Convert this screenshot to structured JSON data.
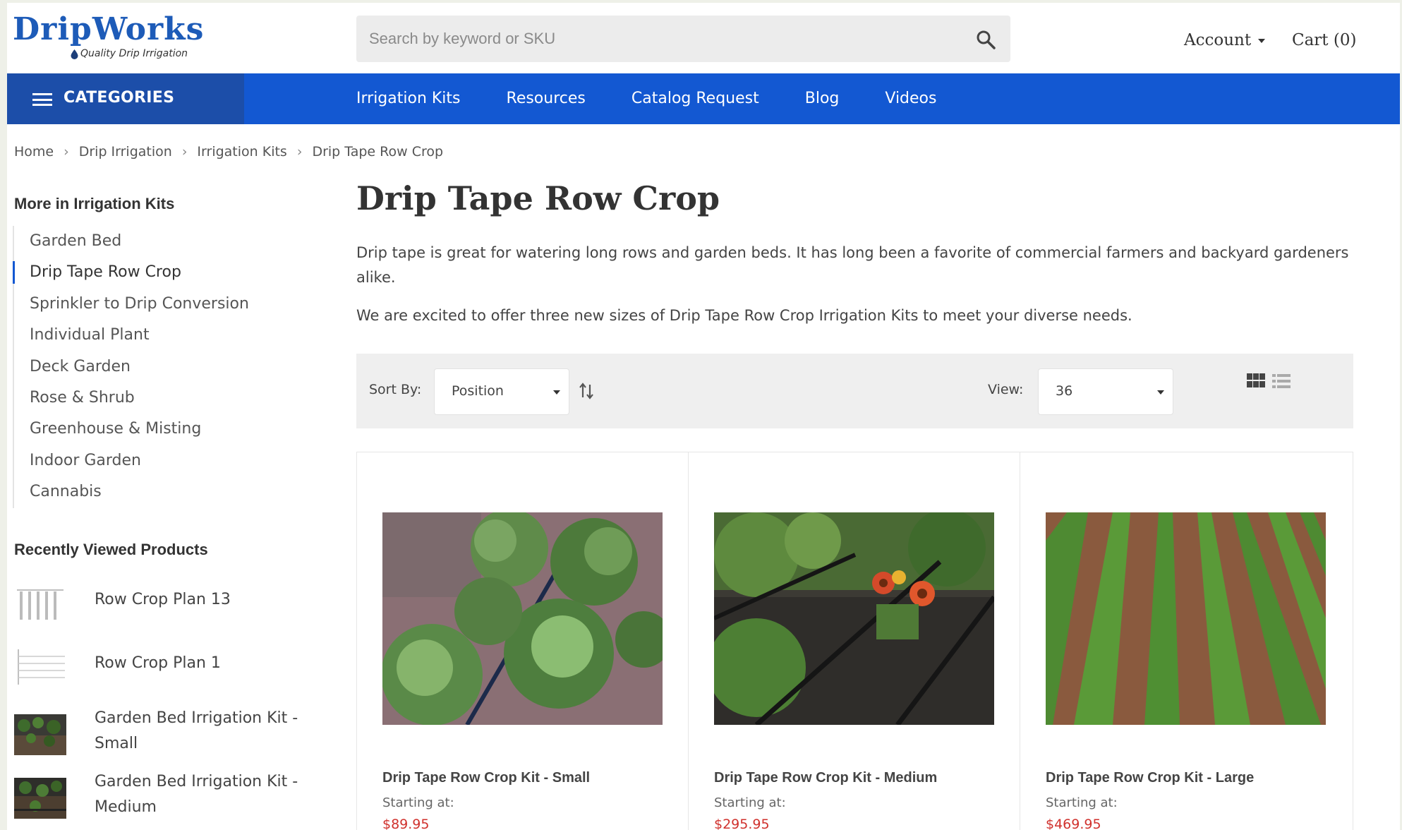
{
  "header": {
    "logo_text": "DripWorks",
    "logo_tagline": "Quality Drip Irrigation",
    "search_placeholder": "Search by keyword or SKU",
    "account_label": "Account",
    "cart_label": "Cart (0)"
  },
  "nav": {
    "categories_label": "CATEGORIES",
    "links": [
      "Irrigation Kits",
      "Resources",
      "Catalog Request",
      "Blog",
      "Videos"
    ]
  },
  "breadcrumb": [
    "Home",
    "Drip Irrigation",
    "Irrigation Kits",
    "Drip Tape Row Crop"
  ],
  "sidebar": {
    "more_heading": "More in Irrigation Kits",
    "items": [
      "Garden Bed",
      "Drip Tape Row Crop",
      "Sprinkler to Drip Conversion",
      "Individual Plant",
      "Deck Garden",
      "Rose & Shrub",
      "Greenhouse & Misting",
      "Indoor Garden",
      "Cannabis"
    ],
    "active_item": "Drip Tape Row Crop",
    "recent_heading": "Recently Viewed Products",
    "recent": [
      {
        "name": "Row Crop Plan 13"
      },
      {
        "name": "Row Crop Plan 1"
      },
      {
        "name": "Garden Bed Irrigation Kit - Small"
      },
      {
        "name": "Garden Bed Irrigation Kit - Medium"
      }
    ]
  },
  "main": {
    "title": "Drip Tape Row Crop",
    "desc1": "Drip tape is great for watering long rows and garden beds. It has long been a favorite of commercial farmers and backyard gardeners alike.",
    "desc2": "We are excited to offer three new sizes of Drip Tape Row Crop Irrigation Kits to meet your diverse needs."
  },
  "toolbar": {
    "sort_label": "Sort By:",
    "sort_value": "Position",
    "view_label": "View:",
    "view_value": "36"
  },
  "products": [
    {
      "name": "Drip Tape Row Crop Kit - Small",
      "starting_label": "Starting at:",
      "price": "$89.95"
    },
    {
      "name": "Drip Tape Row Crop Kit - Medium",
      "starting_label": "Starting at:",
      "price": "$295.95"
    },
    {
      "name": "Drip Tape Row Crop Kit - Large",
      "starting_label": "Starting at:",
      "price": "$469.95"
    }
  ],
  "colors": {
    "brand_blue": "#1358d2",
    "categories_bg": "#1c4ea9",
    "price_red": "#d0312d"
  }
}
